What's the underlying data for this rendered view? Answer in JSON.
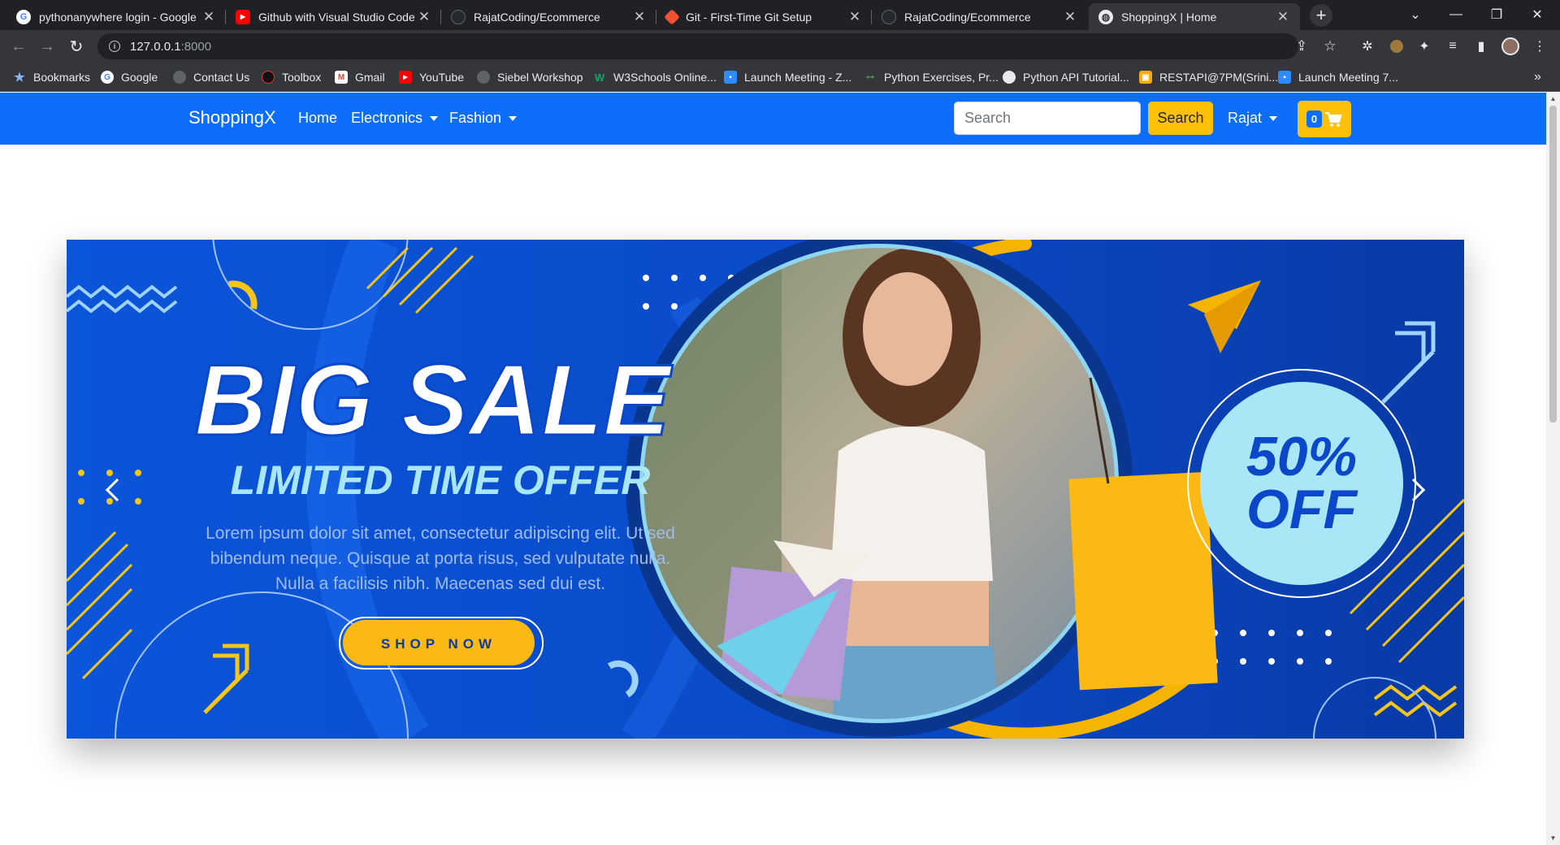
{
  "tabs": [
    {
      "title": "pythonanywhere login - Google",
      "icon": "google-icon",
      "active": false
    },
    {
      "title": "Github with Visual Studio Code (",
      "icon": "youtube-icon",
      "active": false
    },
    {
      "title": "RajatCoding/Ecommerce",
      "icon": "github-icon",
      "active": false
    },
    {
      "title": "Git - First-Time Git Setup",
      "icon": "git-icon",
      "active": false
    },
    {
      "title": "RajatCoding/Ecommerce",
      "icon": "github-icon",
      "active": false
    },
    {
      "title": "ShoppingX | Home",
      "icon": "globe-icon",
      "active": true
    }
  ],
  "address": {
    "host": "127.0.0.1",
    "port": ":8000"
  },
  "bookmarks": [
    {
      "label": "Bookmarks",
      "icon": "star-icon"
    },
    {
      "label": "Google",
      "icon": "google-icon"
    },
    {
      "label": "Contact Us",
      "icon": "globe-icon"
    },
    {
      "label": "Toolbox",
      "icon": "toolbox-icon"
    },
    {
      "label": "Gmail",
      "icon": "gmail-icon"
    },
    {
      "label": "YouTube",
      "icon": "youtube-icon"
    },
    {
      "label": "Siebel Workshop",
      "icon": "globe-icon"
    },
    {
      "label": "W3Schools Online...",
      "icon": "w3schools-icon"
    },
    {
      "label": "Launch Meeting - Z...",
      "icon": "zoom-icon"
    },
    {
      "label": "Python Exercises, Pr...",
      "icon": "pynative-icon"
    },
    {
      "label": "Python API Tutorial...",
      "icon": "python-icon"
    },
    {
      "label": "RESTAPI@7PM(Srini...",
      "icon": "classroom-icon"
    },
    {
      "label": "Launch Meeting 7...",
      "icon": "zoom-icon"
    }
  ],
  "navbar": {
    "brand": "ShoppingX",
    "links": [
      "Home",
      "Electronics",
      "Fashion"
    ],
    "search_placeholder": "Search",
    "search_button": "Search",
    "user": "Rajat",
    "cart_count": "0"
  },
  "banner": {
    "headline": "BIG SALE",
    "subheadline": "LIMITED TIME OFFER",
    "body_lines": [
      "Lorem ipsum dolor sit amet, consectetur adipiscing elit. Ut sed",
      "bibendum neque. Quisque at porta risus, sed vulputate nulla.",
      "Nulla a facilisis nibh. Maecenas sed dui est."
    ],
    "cta": "SHOP NOW",
    "discount_line1": "50%",
    "discount_line2": "OFF"
  },
  "colors": {
    "brand_blue": "#0d6efd",
    "accent_yellow": "#ffc107",
    "banner_blue": "#0a52d6",
    "banner_dark": "#0a3aa8"
  }
}
